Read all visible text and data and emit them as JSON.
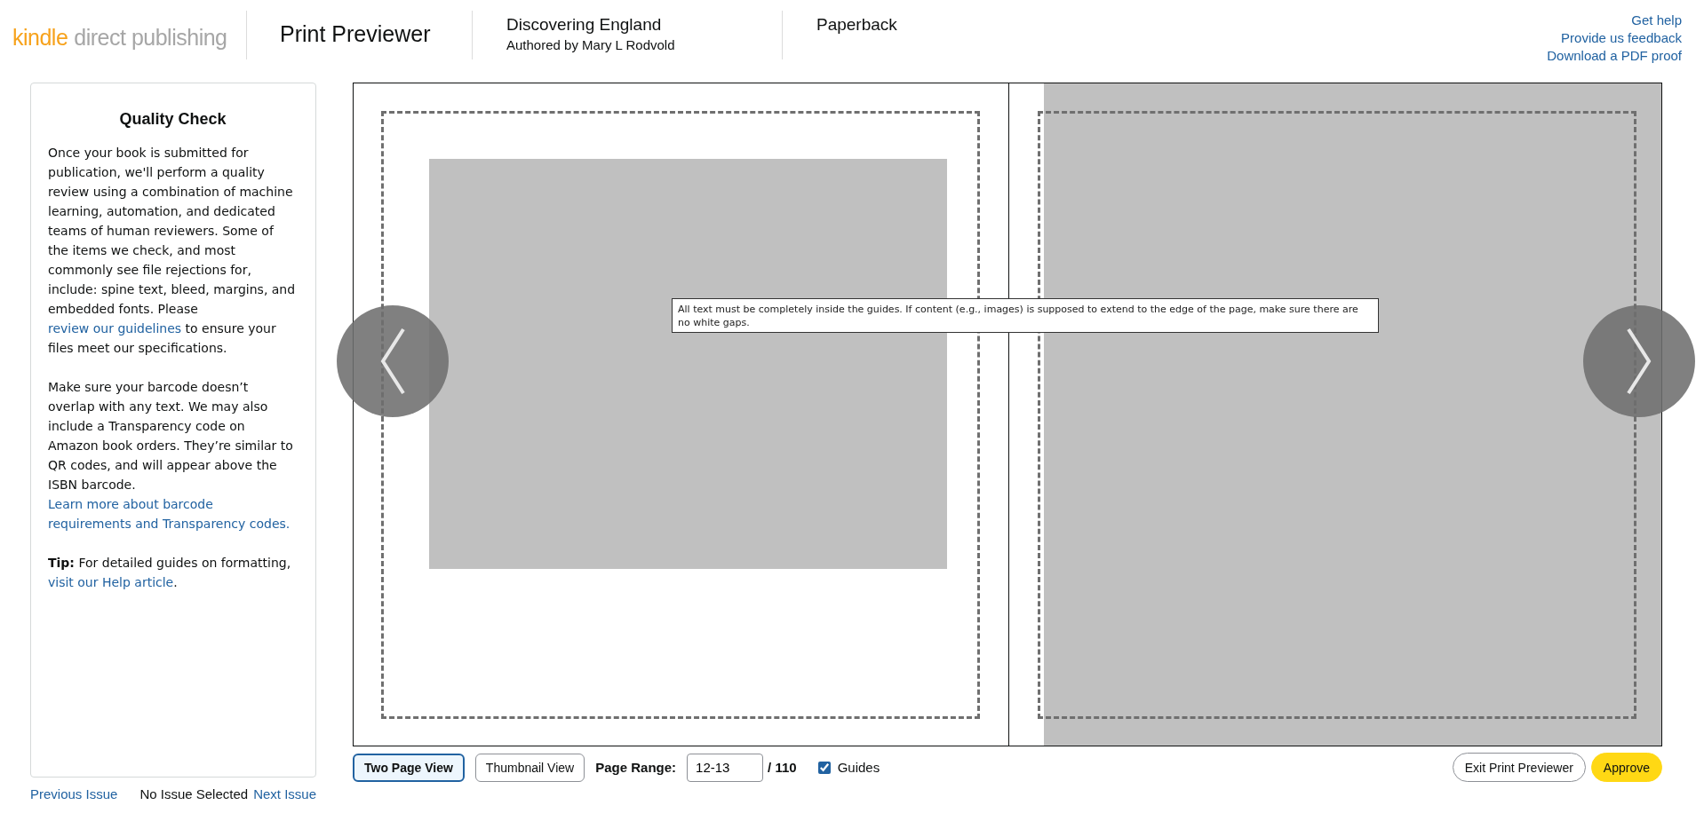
{
  "header": {
    "logo": [
      {
        "text": "kindle",
        "kind": "accent"
      },
      {
        "text": "direct publishing",
        "kind": "muted"
      }
    ],
    "title": "Print Previewer",
    "book": {
      "title": "Discovering England",
      "author": "Authored by Mary L Rodvold"
    },
    "format": "Paperback",
    "links": [
      "Get help",
      "Provide us feedback",
      "Download a PDF proof"
    ]
  },
  "sidebar": {
    "title": "Quality Check",
    "paragraphs": [
      [
        {
          "kind": "text",
          "text": "Once your book is submitted for publication, we'll perform a quality review using a combination of machine learning, automation, and dedicated teams of human reviewers. Some of the items we check, and most commonly see file rejections for, include: spine text, bleed, margins, and embedded fonts. Please "
        },
        {
          "kind": "link",
          "text": "review our guidelines"
        },
        {
          "kind": "text",
          "text": " to ensure your files meet our specifications."
        }
      ],
      [
        {
          "kind": "text",
          "text": "Make sure your barcode doesn’t overlap with any text. We may also include a Transparency code on Amazon book orders. They’re similar to QR codes, and will appear above the ISBN barcode. "
        },
        {
          "kind": "link",
          "text": "Learn more about barcode requirements and Transparency codes."
        }
      ],
      [
        {
          "kind": "text",
          "text": "**Tip:** For detailed guides on formatting, "
        },
        {
          "kind": "link",
          "text": "visit our Help article"
        },
        {
          "kind": "text",
          "text": "."
        }
      ]
    ],
    "nav": {
      "previous": "Previous Issue",
      "status": "No Issue Selected",
      "next": "Next Issue"
    }
  },
  "preview": {
    "tooltip": "All text must be completely inside the guides. If content (e.g., images) is supposed to extend to the edge of the page, make sure there are no white gaps."
  },
  "toolbar": {
    "views": [
      {
        "label": "Two Page View",
        "selected": true
      },
      {
        "label": "Thumbnail View",
        "selected": false
      }
    ],
    "page_range": {
      "label": "Page Range:",
      "value": "12-13",
      "total": "/ 110"
    },
    "guides": {
      "label": "Guides",
      "checked": true
    },
    "buttons": [
      {
        "label": "Exit Print Previewer",
        "kind": "secondary"
      },
      {
        "label": "Approve",
        "kind": "primary"
      }
    ]
  }
}
